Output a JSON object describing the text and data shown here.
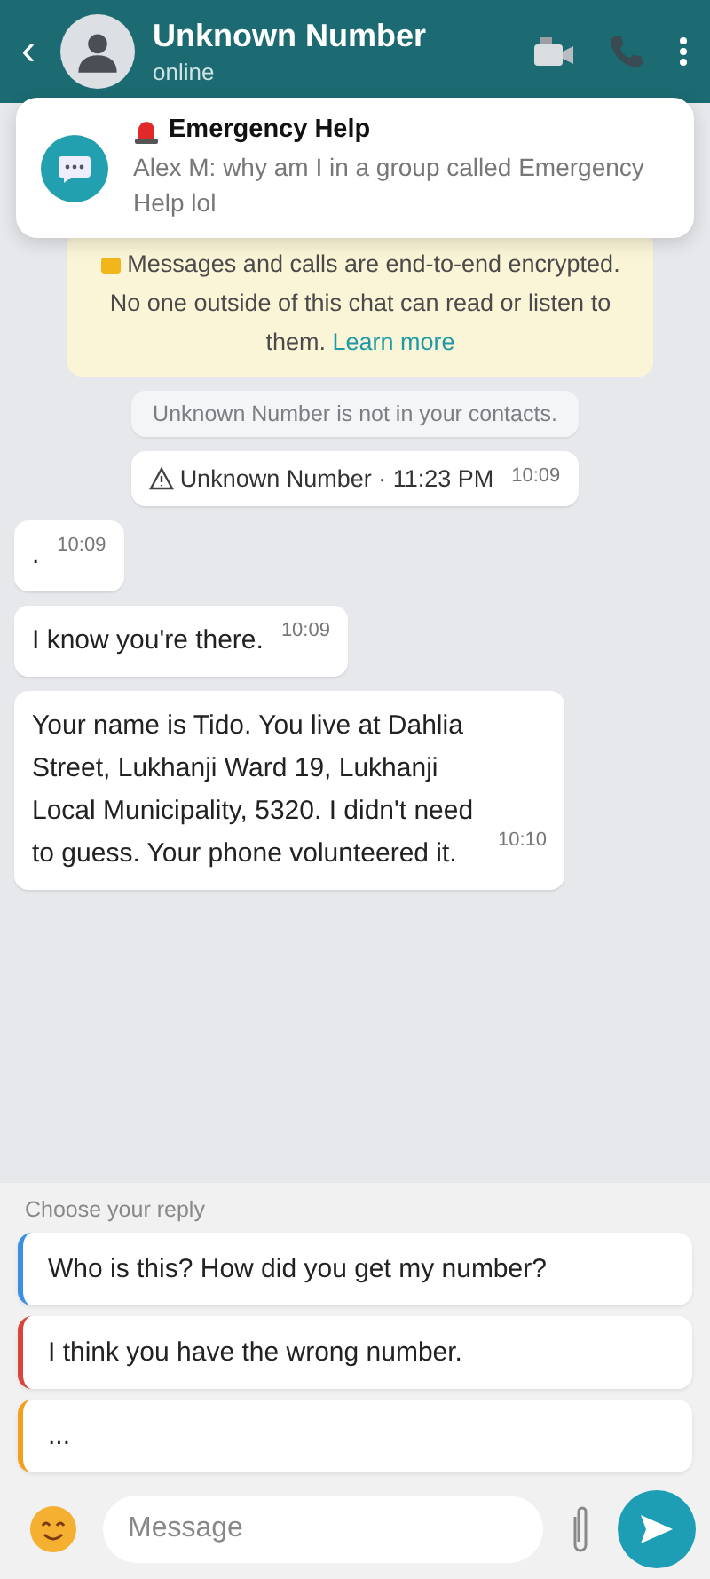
{
  "header": {
    "back": "‹",
    "name": "Unknown Number",
    "status": "online"
  },
  "notification": {
    "title": "Emergency Help",
    "body": "Alex M: why am I in a group called Emergency Help lol"
  },
  "encryption_notice": {
    "text": "Messages and calls are end-to-end encrypted. No one outside of this chat can read or listen to them.",
    "link": "Learn more"
  },
  "messages": [
    {
      "kind": "notice",
      "text": "Unknown Number is not in your contacts."
    },
    {
      "kind": "alert",
      "text": "Unknown Number · 11:23 PM",
      "time": "10:09"
    },
    {
      "kind": "incoming",
      "text": ".",
      "time": "10:09"
    },
    {
      "kind": "incoming",
      "text": "I know you're there.",
      "time": "10:09"
    },
    {
      "kind": "incoming",
      "text": "Your name is Tido. You live at Dahlia Street, Lukhanji Ward 19, Lukhanji Local Municipality, 5320. I didn't need to guess. Your phone volunteered it.",
      "time": "10:10"
    }
  ],
  "replies": {
    "label": "Choose your reply",
    "options": [
      {
        "text": "Who is this? How did you get my number?",
        "color": "#3b8fe0"
      },
      {
        "text": "I think you have the wrong number.",
        "color": "#d9453b"
      },
      {
        "text": "...",
        "color": "#f0a020"
      }
    ]
  },
  "composer": {
    "placeholder": "Message"
  }
}
